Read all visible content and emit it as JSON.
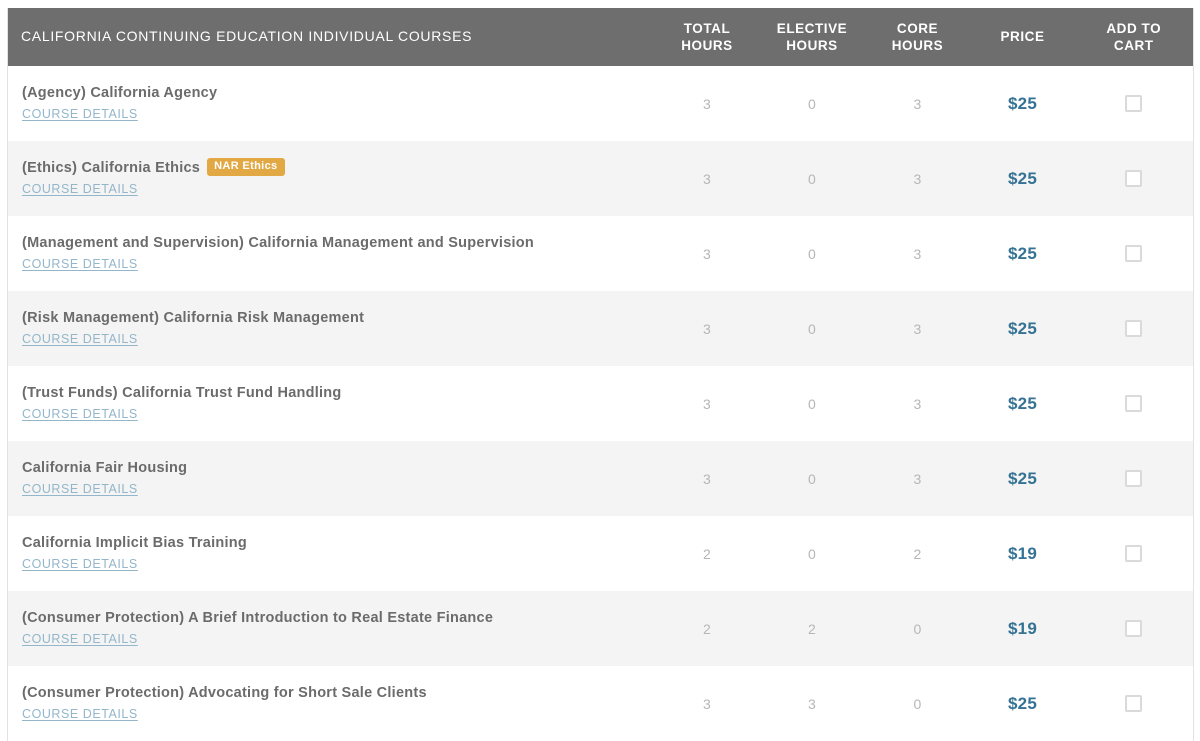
{
  "table": {
    "header": {
      "title": "California Continuing Education Individual Courses",
      "total_hours": {
        "line1": "Total",
        "line2": "Hours"
      },
      "elective_hours": {
        "line1": "Elective",
        "line2": "Hours"
      },
      "core_hours": {
        "line1": "Core",
        "line2": "Hours"
      },
      "price": "Price",
      "add_to_cart": {
        "line1": "Add To",
        "line2": "Cart"
      }
    },
    "details_link_label": "Course Details",
    "colors": {
      "header_background": "#6e6e6e",
      "header_text": "#ffffff",
      "row_even_background": "#ffffff",
      "row_odd_background": "#f4f4f4",
      "course_title": "#6b6b6b",
      "details_link": "#93b6ca",
      "hours_value": "#b6b6b6",
      "price": "#357294",
      "badge_background": "#e2a844",
      "badge_text": "#ffffff",
      "checkbox_border": "#dadada",
      "table_border": "#e2e2e2"
    },
    "rows": [
      {
        "name": "(Agency) California Agency",
        "badge": "",
        "details": "Course Details",
        "total_hours": "3",
        "elective_hours": "0",
        "core_hours": "3",
        "price": "$25",
        "cart_checked": false
      },
      {
        "name": "(Ethics) California Ethics",
        "badge": "NAR Ethics",
        "details": "Course Details",
        "total_hours": "3",
        "elective_hours": "0",
        "core_hours": "3",
        "price": "$25",
        "cart_checked": false
      },
      {
        "name": "(Management and Supervision) California Management and Supervision",
        "badge": "",
        "details": "Course Details",
        "total_hours": "3",
        "elective_hours": "0",
        "core_hours": "3",
        "price": "$25",
        "cart_checked": false
      },
      {
        "name": "(Risk Management) California Risk Management",
        "badge": "",
        "details": "Course Details",
        "total_hours": "3",
        "elective_hours": "0",
        "core_hours": "3",
        "price": "$25",
        "cart_checked": false
      },
      {
        "name": "(Trust Funds) California Trust Fund Handling",
        "badge": "",
        "details": "Course Details",
        "total_hours": "3",
        "elective_hours": "0",
        "core_hours": "3",
        "price": "$25",
        "cart_checked": false
      },
      {
        "name": "California Fair Housing",
        "badge": "",
        "details": "Course Details",
        "total_hours": "3",
        "elective_hours": "0",
        "core_hours": "3",
        "price": "$25",
        "cart_checked": false
      },
      {
        "name": "California Implicit Bias Training",
        "badge": "",
        "details": "Course Details",
        "total_hours": "2",
        "elective_hours": "0",
        "core_hours": "2",
        "price": "$19",
        "cart_checked": false
      },
      {
        "name": "(Consumer Protection) A Brief Introduction to Real Estate Finance",
        "badge": "",
        "details": "Course Details",
        "total_hours": "2",
        "elective_hours": "2",
        "core_hours": "0",
        "price": "$19",
        "cart_checked": false
      },
      {
        "name": "(Consumer Protection) Advocating for Short Sale Clients",
        "badge": "",
        "details": "Course Details",
        "total_hours": "3",
        "elective_hours": "3",
        "core_hours": "0",
        "price": "$25",
        "cart_checked": false
      }
    ]
  }
}
